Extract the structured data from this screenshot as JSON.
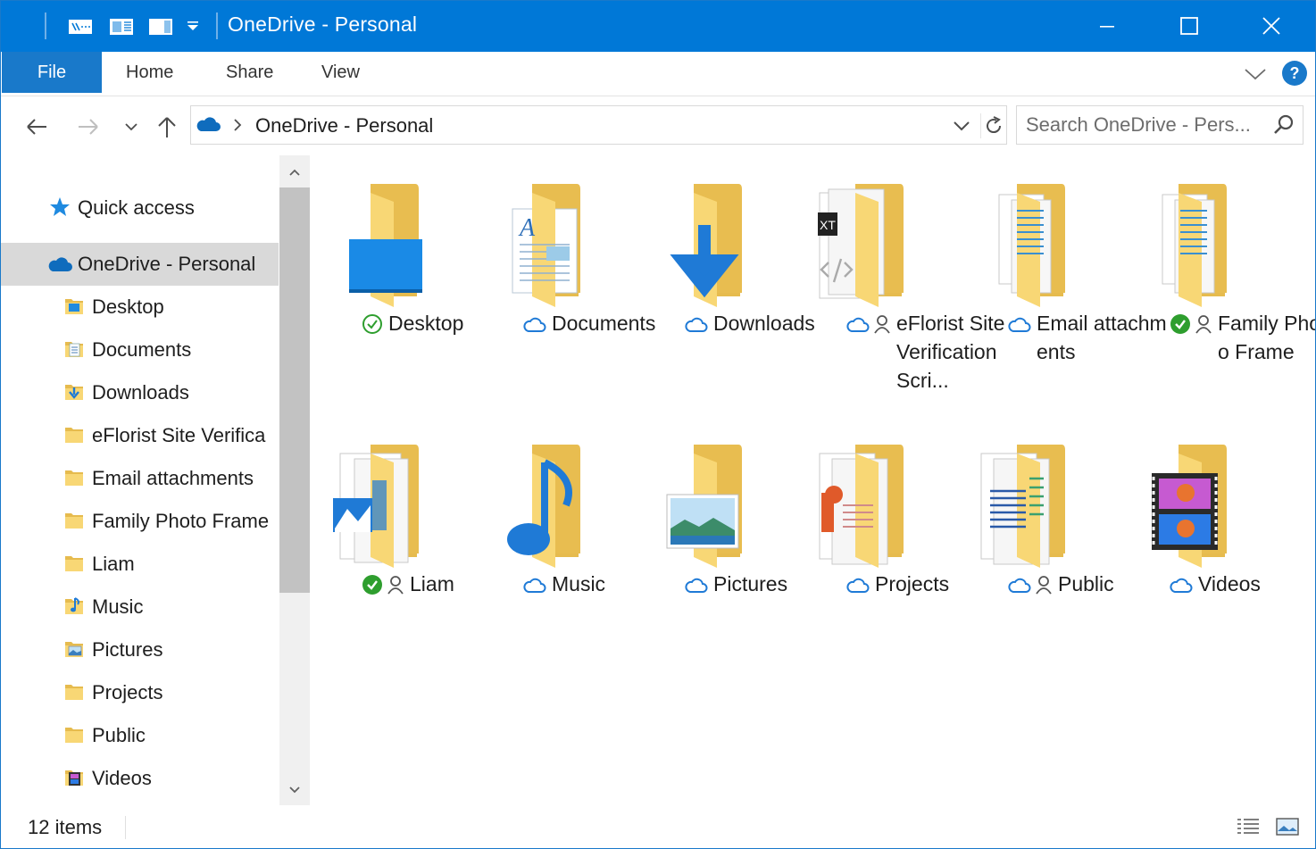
{
  "window": {
    "title": "OneDrive - Personal",
    "accent": "#0078d7"
  },
  "ribbon": {
    "tabs": [
      {
        "label": "File"
      },
      {
        "label": "Home"
      },
      {
        "label": "Share"
      },
      {
        "label": "View"
      }
    ],
    "help_label": "?"
  },
  "nav": {
    "breadcrumb": "OneDrive - Personal",
    "search_placeholder": "Search OneDrive - Pers..."
  },
  "sidebar": {
    "quick_access": "Quick access",
    "onedrive": "OneDrive - Personal",
    "items": [
      {
        "label": "Desktop",
        "icon": "desktop-folder-icon"
      },
      {
        "label": "Documents",
        "icon": "documents-folder-icon"
      },
      {
        "label": "Downloads",
        "icon": "downloads-folder-icon"
      },
      {
        "label": "eFlorist Site Verifica",
        "icon": "folder-icon"
      },
      {
        "label": "Email attachments",
        "icon": "folder-icon"
      },
      {
        "label": "Family Photo Frame",
        "icon": "folder-icon"
      },
      {
        "label": "Liam",
        "icon": "folder-icon"
      },
      {
        "label": "Music",
        "icon": "music-folder-icon"
      },
      {
        "label": "Pictures",
        "icon": "pictures-folder-icon"
      },
      {
        "label": "Projects",
        "icon": "folder-icon"
      },
      {
        "label": "Public",
        "icon": "folder-icon"
      },
      {
        "label": "Videos",
        "icon": "videos-folder-icon"
      }
    ]
  },
  "content": {
    "folders": [
      {
        "name": "Desktop",
        "status": [
          "synced-check"
        ]
      },
      {
        "name": "Documents",
        "status": [
          "cloud"
        ]
      },
      {
        "name": "Downloads",
        "status": [
          "cloud"
        ]
      },
      {
        "name": "eFlorist Site Verification Scri...",
        "status": [
          "cloud",
          "shared"
        ]
      },
      {
        "name": "Email attachments",
        "status": [
          "cloud"
        ]
      },
      {
        "name": "Family Photo Frame",
        "status": [
          "always-available",
          "shared"
        ]
      },
      {
        "name": "Liam",
        "status": [
          "always-available",
          "shared"
        ]
      },
      {
        "name": "Music",
        "status": [
          "cloud"
        ]
      },
      {
        "name": "Pictures",
        "status": [
          "cloud"
        ]
      },
      {
        "name": "Projects",
        "status": [
          "cloud"
        ]
      },
      {
        "name": "Public",
        "status": [
          "cloud",
          "shared"
        ]
      },
      {
        "name": "Videos",
        "status": [
          "cloud"
        ]
      }
    ]
  },
  "statusbar": {
    "count": "12 items"
  }
}
